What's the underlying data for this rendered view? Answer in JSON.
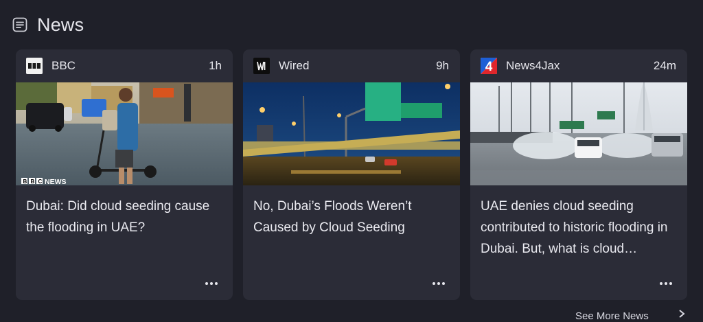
{
  "section": {
    "title": "News",
    "icon": "news-list-icon"
  },
  "cards": [
    {
      "source": "BBC",
      "time": "1h",
      "logo_icon": "bbc-logo-icon",
      "image_caption": "BBC NEWS",
      "headline": "Dubai: Did cloud seeding cause the flooding in UAE?"
    },
    {
      "source": "Wired",
      "time": "9h",
      "logo_icon": "wired-logo-icon",
      "headline": "No, Dubai’s Floods Weren’t Caused by Cloud Seeding"
    },
    {
      "source": "News4Jax",
      "time": "24m",
      "logo_icon": "news4jax-logo-icon",
      "logo_text": "4",
      "headline": "UAE denies cloud seeding contributed to historic flooding in Dubai. But, what is cloud…"
    }
  ],
  "footer": {
    "see_more": "See More News"
  },
  "colors": {
    "background": "#1f2029",
    "card": "#2b2c37",
    "text": "#eaeaf0",
    "news4jax_blue": "#1e5fd6",
    "news4jax_red": "#e0262b"
  }
}
